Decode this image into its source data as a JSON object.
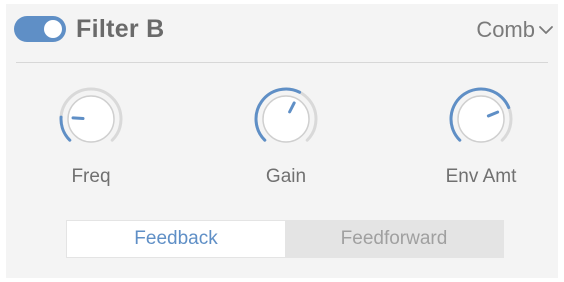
{
  "header": {
    "title": "Filter B",
    "enabled": true,
    "mode": {
      "value": "Comb"
    }
  },
  "knobs": [
    {
      "label": "Freq",
      "value_fraction": 0.18
    },
    {
      "label": "Gain",
      "value_fraction": 0.6
    },
    {
      "label": "Env Amt",
      "value_fraction": 0.75
    }
  ],
  "segmented": {
    "options": [
      {
        "label": "Feedback",
        "active": true
      },
      {
        "label": "Feedforward",
        "active": false
      }
    ]
  },
  "colors": {
    "accent": "#5f8fc6",
    "panel_bg": "#f4f4f4",
    "text": "#707070",
    "inactive_text": "#a0a0a0"
  },
  "icons": {
    "mode_dropdown": "chevron-down-icon"
  }
}
